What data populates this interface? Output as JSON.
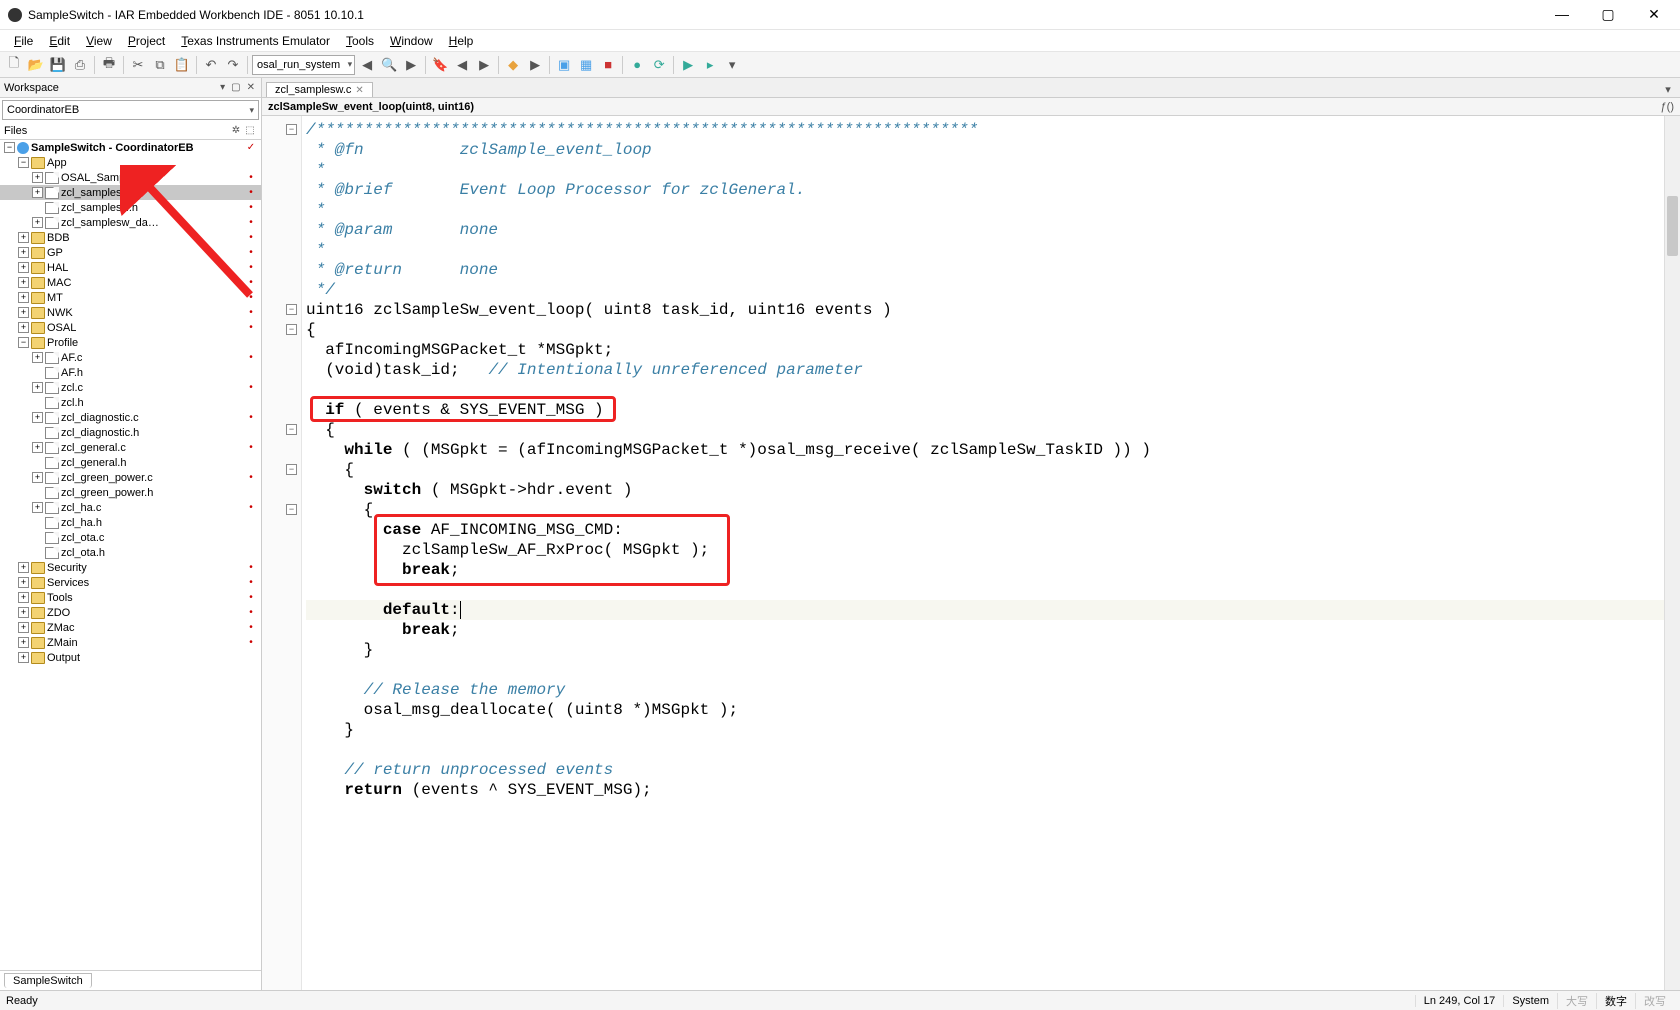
{
  "window": {
    "title": "SampleSwitch - IAR Embedded Workbench IDE - 8051 10.10.1"
  },
  "menu": {
    "items": [
      "File",
      "Edit",
      "View",
      "Project",
      "Texas Instruments Emulator",
      "Tools",
      "Window",
      "Help"
    ]
  },
  "toolbar": {
    "search_value": "osal_run_system"
  },
  "workspace": {
    "title": "Workspace",
    "config": "CoordinatorEB",
    "files_label": "Files",
    "project": "SampleSwitch - CoordinatorEB",
    "tree": [
      {
        "depth": 0,
        "type": "target",
        "label": "SampleSwitch - CoordinatorEB",
        "toggle": "-",
        "check": true
      },
      {
        "depth": 1,
        "type": "folder",
        "label": "App",
        "toggle": "-"
      },
      {
        "depth": 2,
        "type": "file",
        "label": "OSAL_SampleSw.c",
        "toggle": "+",
        "dot": true
      },
      {
        "depth": 2,
        "type": "file",
        "label": "zcl_samplesw.c",
        "toggle": "+",
        "dot": true,
        "selected": true
      },
      {
        "depth": 2,
        "type": "file",
        "label": "zcl_samplesw.h",
        "toggle": "",
        "dot": true
      },
      {
        "depth": 2,
        "type": "file",
        "label": "zcl_samplesw_da…",
        "toggle": "+",
        "dot": true
      },
      {
        "depth": 1,
        "type": "folder",
        "label": "BDB",
        "toggle": "+",
        "dot": true
      },
      {
        "depth": 1,
        "type": "folder",
        "label": "GP",
        "toggle": "+",
        "dot": true
      },
      {
        "depth": 1,
        "type": "folder",
        "label": "HAL",
        "toggle": "+",
        "dot": true
      },
      {
        "depth": 1,
        "type": "folder",
        "label": "MAC",
        "toggle": "+",
        "dot": true
      },
      {
        "depth": 1,
        "type": "folder",
        "label": "MT",
        "toggle": "+",
        "dot": true
      },
      {
        "depth": 1,
        "type": "folder",
        "label": "NWK",
        "toggle": "+",
        "dot": true
      },
      {
        "depth": 1,
        "type": "folder",
        "label": "OSAL",
        "toggle": "+",
        "dot": true
      },
      {
        "depth": 1,
        "type": "folder",
        "label": "Profile",
        "toggle": "-"
      },
      {
        "depth": 2,
        "type": "file",
        "label": "AF.c",
        "toggle": "+",
        "dot": true
      },
      {
        "depth": 2,
        "type": "file",
        "label": "AF.h",
        "toggle": ""
      },
      {
        "depth": 2,
        "type": "file",
        "label": "zcl.c",
        "toggle": "+",
        "dot": true
      },
      {
        "depth": 2,
        "type": "file",
        "label": "zcl.h",
        "toggle": ""
      },
      {
        "depth": 2,
        "type": "file",
        "label": "zcl_diagnostic.c",
        "toggle": "+",
        "dot": true
      },
      {
        "depth": 2,
        "type": "file",
        "label": "zcl_diagnostic.h",
        "toggle": ""
      },
      {
        "depth": 2,
        "type": "file",
        "label": "zcl_general.c",
        "toggle": "+",
        "dot": true
      },
      {
        "depth": 2,
        "type": "file",
        "label": "zcl_general.h",
        "toggle": ""
      },
      {
        "depth": 2,
        "type": "file",
        "label": "zcl_green_power.c",
        "toggle": "+",
        "dot": true
      },
      {
        "depth": 2,
        "type": "file",
        "label": "zcl_green_power.h",
        "toggle": ""
      },
      {
        "depth": 2,
        "type": "file",
        "label": "zcl_ha.c",
        "toggle": "+",
        "dot": true
      },
      {
        "depth": 2,
        "type": "file",
        "label": "zcl_ha.h",
        "toggle": ""
      },
      {
        "depth": 2,
        "type": "file",
        "label": "zcl_ota.c",
        "toggle": ""
      },
      {
        "depth": 2,
        "type": "file",
        "label": "zcl_ota.h",
        "toggle": ""
      },
      {
        "depth": 1,
        "type": "folder",
        "label": "Security",
        "toggle": "+",
        "dot": true
      },
      {
        "depth": 1,
        "type": "folder",
        "label": "Services",
        "toggle": "+",
        "dot": true
      },
      {
        "depth": 1,
        "type": "folder",
        "label": "Tools",
        "toggle": "+",
        "dot": true
      },
      {
        "depth": 1,
        "type": "folder",
        "label": "ZDO",
        "toggle": "+",
        "dot": true
      },
      {
        "depth": 1,
        "type": "folder",
        "label": "ZMac",
        "toggle": "+",
        "dot": true
      },
      {
        "depth": 1,
        "type": "folder",
        "label": "ZMain",
        "toggle": "+",
        "dot": true
      },
      {
        "depth": 1,
        "type": "folder",
        "label": "Output",
        "toggle": "+"
      }
    ],
    "bottom_tab": "SampleSwitch"
  },
  "editor": {
    "tab": "zcl_samplesw.c",
    "breadcrumb": "zclSampleSw_event_loop(uint8, uint16)",
    "code_lines": [
      {
        "t": "/*********************************************************************",
        "cls": "doc"
      },
      {
        "t": " * @fn          zclSample_event_loop",
        "cls": "doc"
      },
      {
        "t": " *",
        "cls": "doc"
      },
      {
        "t": " * @brief       Event Loop Processor for zclGeneral.",
        "cls": "doc"
      },
      {
        "t": " *",
        "cls": "doc"
      },
      {
        "t": " * @param       none",
        "cls": "doc"
      },
      {
        "t": " *",
        "cls": "doc"
      },
      {
        "t": " * @return      none",
        "cls": "doc"
      },
      {
        "t": " */",
        "cls": "doc"
      },
      {
        "t": "uint16 zclSampleSw_event_loop( uint8 task_id, uint16 events )",
        "cls": ""
      },
      {
        "t": "{",
        "cls": ""
      },
      {
        "t": "  afIncomingMSGPacket_t *MSGpkt;",
        "cls": ""
      },
      {
        "t": "  (void)task_id;   // Intentionally unreferenced parameter",
        "cls": "",
        "half_cm": "  (void)task_id;   ",
        "cm": "// Intentionally unreferenced parameter"
      },
      {
        "t": "",
        "cls": ""
      },
      {
        "t": "  if ( events & SYS_EVENT_MSG )",
        "cls": "",
        "box": 1
      },
      {
        "t": "  {",
        "cls": ""
      },
      {
        "t": "    while ( (MSGpkt = (afIncomingMSGPacket_t *)osal_msg_receive( zclSampleSw_TaskID )) )",
        "cls": ""
      },
      {
        "t": "    {",
        "cls": ""
      },
      {
        "t": "      switch ( MSGpkt->hdr.event )",
        "cls": ""
      },
      {
        "t": "      {",
        "cls": ""
      },
      {
        "t": "        case AF_INCOMING_MSG_CMD:",
        "cls": "",
        "box": 2
      },
      {
        "t": "          zclSampleSw_AF_RxProc( MSGpkt );",
        "cls": ""
      },
      {
        "t": "          break;",
        "cls": ""
      },
      {
        "t": "",
        "cls": ""
      },
      {
        "t": "        default:",
        "cls": "",
        "hl": true,
        "cursor": true
      },
      {
        "t": "          break;",
        "cls": ""
      },
      {
        "t": "      }",
        "cls": ""
      },
      {
        "t": "",
        "cls": ""
      },
      {
        "t": "      // Release the memory",
        "cls": "cm"
      },
      {
        "t": "      osal_msg_deallocate( (uint8 *)MSGpkt );",
        "cls": ""
      },
      {
        "t": "    }",
        "cls": ""
      },
      {
        "t": "",
        "cls": ""
      },
      {
        "t": "    // return unprocessed events",
        "cls": "cm"
      },
      {
        "t": "    return (events ^ SYS_EVENT_MSG);",
        "cls": ""
      }
    ]
  },
  "status": {
    "ready": "Ready",
    "pos": "Ln 249, Col 17",
    "system": "System",
    "ime": [
      "大写",
      "数字",
      "改写"
    ]
  },
  "annotations": {
    "arrow_target": "zcl_samplesw.c"
  }
}
